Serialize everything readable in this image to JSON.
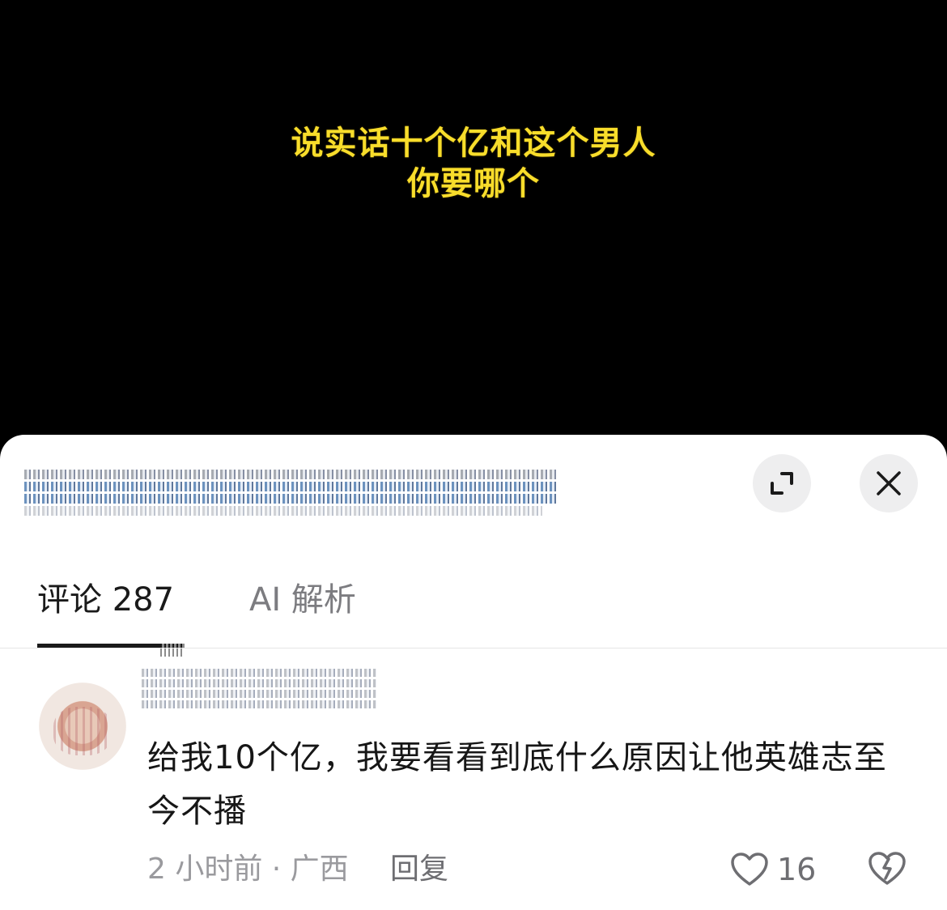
{
  "video": {
    "caption_line1": "说实话十个亿和这个男人",
    "caption_line2": "你要哪个",
    "caption_color": "#f8dd2b"
  },
  "sheet": {
    "expand_icon": "expand-icon",
    "close_icon": "close-icon"
  },
  "tabs": [
    {
      "label": "评论 287",
      "active": true
    },
    {
      "label": "AI 解析",
      "active": false
    }
  ],
  "comment": {
    "text": "给我10个亿，我要看看到底什么原因让他英雄志至今不播",
    "time_location": "2 小时前 · 广西",
    "reply_label": "回复",
    "like_count": "16",
    "like_icon": "heart-outline-icon",
    "dislike_icon": "broken-heart-icon"
  }
}
